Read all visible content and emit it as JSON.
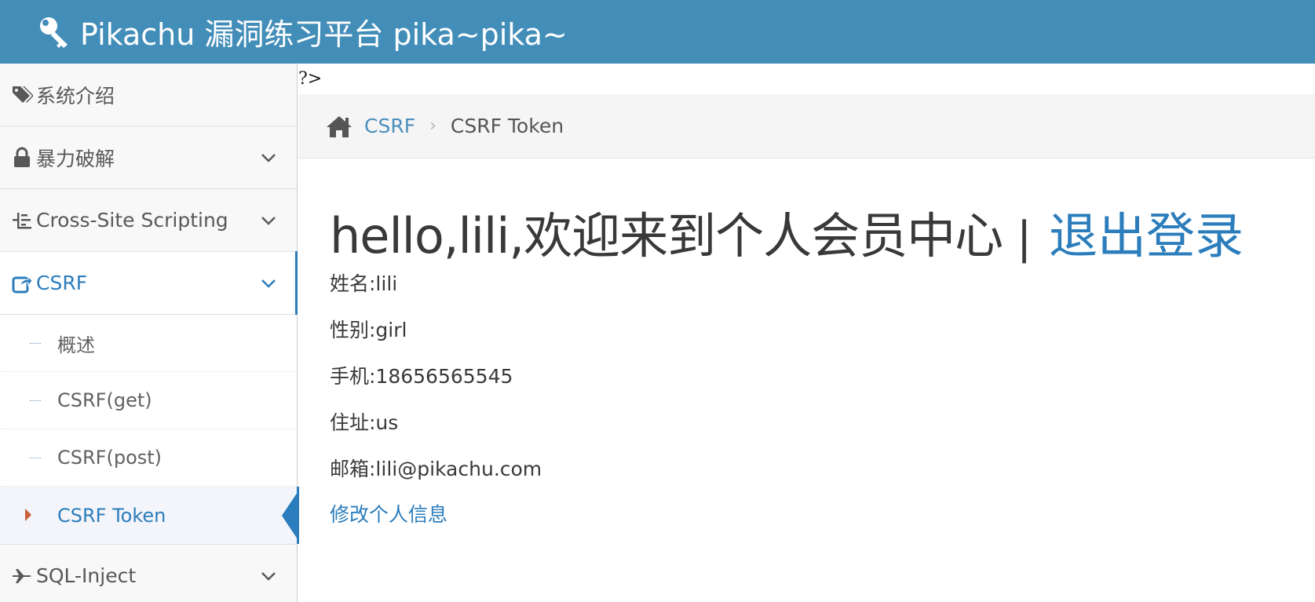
{
  "header": {
    "brand_icon": "key-icon",
    "title": "Pikachu 漏洞练习平台 pika~pika~"
  },
  "sidebar": {
    "items": [
      {
        "label": "系统介绍",
        "icon": "tags-icon"
      },
      {
        "label": "暴力破解",
        "icon": "lock-icon"
      },
      {
        "label": "Cross-Site Scripting",
        "icon": "xss-icon"
      },
      {
        "label": "CSRF",
        "icon": "share-square-icon"
      },
      {
        "label": "SQL-Inject",
        "icon": "plane-icon"
      }
    ],
    "csrf_submenu": [
      {
        "label": "概述"
      },
      {
        "label": "CSRF(get)"
      },
      {
        "label": "CSRF(post)"
      },
      {
        "label": "CSRF Token"
      }
    ]
  },
  "stray_text": "?>",
  "breadcrumbs": {
    "home_icon": "home-icon",
    "link": "CSRF",
    "separator": "›",
    "current": "CSRF Token"
  },
  "main": {
    "greeting": "hello,lili,欢迎来到个人会员中心",
    "divider": "|",
    "logout": "退出登录",
    "fields": [
      "姓名:lili",
      "性别:girl",
      "手机:18656565545",
      "住址:us",
      "邮箱:lili@pikachu.com"
    ],
    "edit_link": "修改个人信息"
  },
  "colors": {
    "navbar": "#438eb9",
    "accent": "#2b7dbc",
    "text": "#393939"
  }
}
